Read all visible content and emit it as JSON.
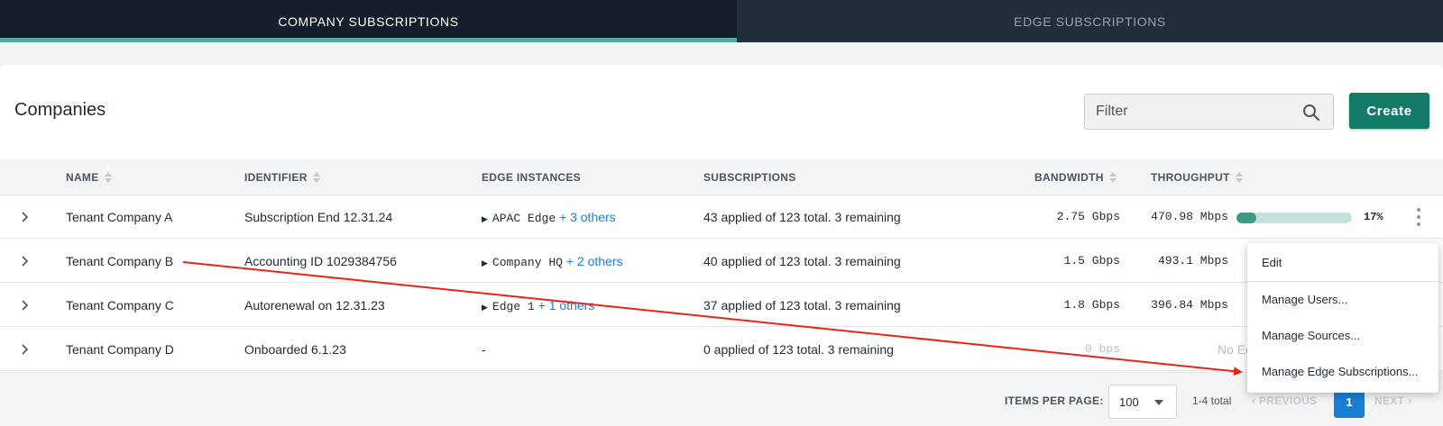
{
  "tabs": [
    {
      "label": "COMPANY SUBSCRIPTIONS",
      "active": true
    },
    {
      "label": "EDGE SUBSCRIPTIONS",
      "active": false
    }
  ],
  "card": {
    "title": "Companies",
    "filter_placeholder": "Filter",
    "create_label": "Create"
  },
  "table": {
    "headers": {
      "name": "NAME",
      "identifier": "IDENTIFIER",
      "edge_instances": "EDGE INSTANCES",
      "subscriptions": "SUBSCRIPTIONS",
      "bandwidth": "BANDWIDTH",
      "throughput": "THROUGHPUT"
    },
    "rows": [
      {
        "name": "Tenant Company A",
        "identifier": "Subscription End 12.31.24",
        "edge": "APAC Edge",
        "edge_more": "+ 3 others",
        "subscriptions": "43 applied of 123 total. 3 remaining",
        "bandwidth": "2.75 Gbps",
        "throughput": "470.98 Mbps",
        "percent_text": "17%",
        "fill": 0.17
      },
      {
        "name": "Tenant Company B",
        "identifier": "Accounting ID 1029384756",
        "edge": "Company HQ",
        "edge_more": "+ 2 others",
        "subscriptions": "40 applied of 123 total. 3 remaining",
        "bandwidth": "1.5 Gbps",
        "throughput": "493.1 Mbps"
      },
      {
        "name": "Tenant Company C",
        "identifier": "Autorenewal on 12.31.23",
        "edge": "Edge 1",
        "edge_more": "+ 1 others",
        "subscriptions": "37 applied of 123 total. 3 remaining",
        "bandwidth": "1.8 Gbps",
        "throughput": "396.84 Mbps"
      },
      {
        "name": "Tenant Company D",
        "identifier": "Onboarded 6.1.23",
        "edge_none": "-",
        "subscriptions": "0 applied of 123 total. 3 remaining",
        "bandwidth": "0 bps",
        "throughput": "No Ed"
      }
    ]
  },
  "footer": {
    "items_per_page_label": "ITEMS PER PAGE:",
    "items_per_page_value": "100",
    "total": "1-4 total",
    "previous": "PREVIOUS",
    "page": "1",
    "next": "NEXT"
  },
  "menu": {
    "items": [
      "Edit",
      "Manage Users...",
      "Manage Sources...",
      "Manage Edge Subscriptions..."
    ]
  },
  "colors": {
    "accent": "#127a67",
    "link": "#1a7fd4",
    "annotation_arrow": "#e8231c"
  }
}
